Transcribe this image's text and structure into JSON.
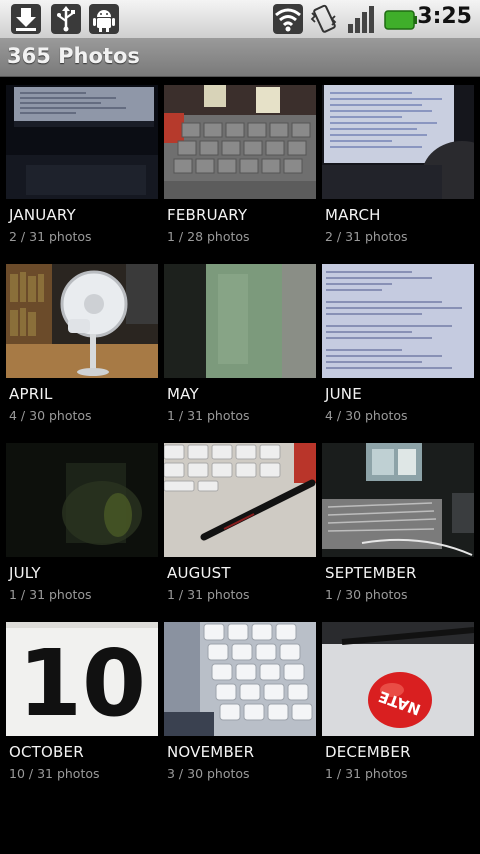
{
  "status_bar": {
    "time": "3:25",
    "icons": [
      "download-icon",
      "usb-icon",
      "android-debug-icon",
      "wifi-icon",
      "vibrate-icon",
      "signal-icon",
      "battery-icon"
    ]
  },
  "app": {
    "title": "365 Photos"
  },
  "months": [
    {
      "name": "JANUARY",
      "count": "2 / 31 photos"
    },
    {
      "name": "FEBRUARY",
      "count": "1 / 28 photos"
    },
    {
      "name": "MARCH",
      "count": "2 / 31 photos"
    },
    {
      "name": "APRIL",
      "count": "4 / 30 photos"
    },
    {
      "name": "MAY",
      "count": "1 / 31 photos"
    },
    {
      "name": "JUNE",
      "count": "4 / 30 photos"
    },
    {
      "name": "JULY",
      "count": "1 / 31 photos"
    },
    {
      "name": "AUGUST",
      "count": "1 / 31 photos"
    },
    {
      "name": "SEPTEMBER",
      "count": "1 / 30 photos"
    },
    {
      "name": "OCTOBER",
      "count": "10 / 31 photos"
    },
    {
      "name": "NOVEMBER",
      "count": "3 / 30 photos"
    },
    {
      "name": "DECEMBER",
      "count": "1 / 31 photos"
    }
  ],
  "thumb_text": {
    "october": "10",
    "december": "NATE"
  }
}
